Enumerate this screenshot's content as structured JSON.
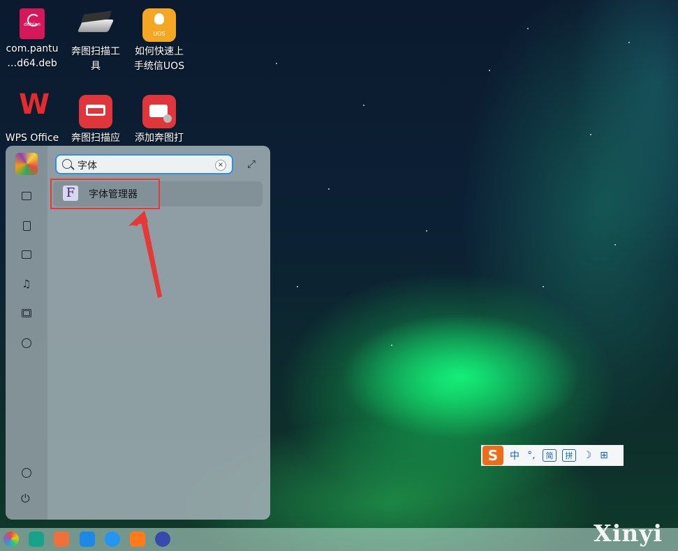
{
  "desktop": {
    "icons": [
      {
        "label": "com.pantu\n…d64.deb",
        "line1": "com.pantu",
        "line2": "…d64.deb",
        "badge": "debian"
      },
      {
        "line1": "奔图扫描工",
        "line2": "具"
      },
      {
        "line1": "如何快速上",
        "line2": "手统信UOS",
        "badge": "UOS"
      },
      {
        "line1": "WPS Office",
        "line2": "",
        "badge": "W"
      },
      {
        "line1": "奔图扫描应",
        "line2": ""
      },
      {
        "line1": "添加奔图打",
        "line2": ""
      }
    ]
  },
  "launcher": {
    "search": {
      "query": "字体",
      "clear_symbol": "×"
    },
    "expand_symbol": "⤢",
    "results": [
      {
        "icon_letter": "F",
        "label": "字体管理器"
      }
    ]
  },
  "ime": {
    "logo": "S",
    "items": [
      "中",
      "°,",
      "简",
      "拼",
      "☽",
      "⊞"
    ]
  },
  "watermark": "Xinyi",
  "colors": {
    "accent": "#2f8fe0",
    "highlight": "#e53935",
    "ime_blue": "#1565c0"
  }
}
